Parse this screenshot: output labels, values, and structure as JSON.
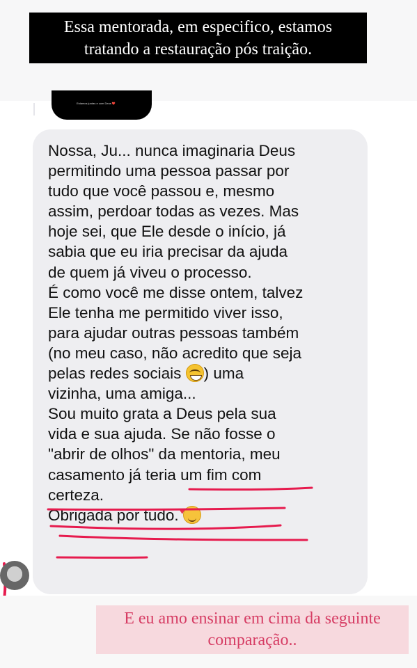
{
  "story": {
    "top_caption": [
      "Essa mentorada, em especifico, estamos",
      "tratando a restauração pós traição."
    ],
    "bottom_caption": [
      "E eu amo ensinar em cima da seguinte",
      "comparação.."
    ]
  },
  "chat": {
    "message_lines": [
      "Nossa, Ju... nunca imaginaria Deus",
      "permitindo uma pessoa passar por",
      "tudo que você passou e, mesmo",
      "assim, perdoar todas as vezes. Mas",
      "hoje sei, que Ele desde o início, já",
      "sabia que eu iria precisar da ajuda",
      "de quem já viveu o processo.",
      "É como você me disse ontem, talvez",
      "Ele tenha me permitido viver isso,",
      "para ajudar outras pessoas também",
      "(no meu caso, não acredito que seja",
      "pelas redes sociais",
      ") uma",
      "vizinha, uma amiga...",
      "Sou muito grata a Deus pela sua",
      "vida e sua ajuda. Se não fosse o",
      "\"abrir de olhos\" da mentoria, meu",
      "casamento já teria um fim com",
      "certeza.",
      "Obrigada por tudo."
    ],
    "emojis": [
      "grinning-sweat-emoji",
      "smiling-face-with-hearts-emoji"
    ],
    "highlight_color": "#e61b4e"
  }
}
